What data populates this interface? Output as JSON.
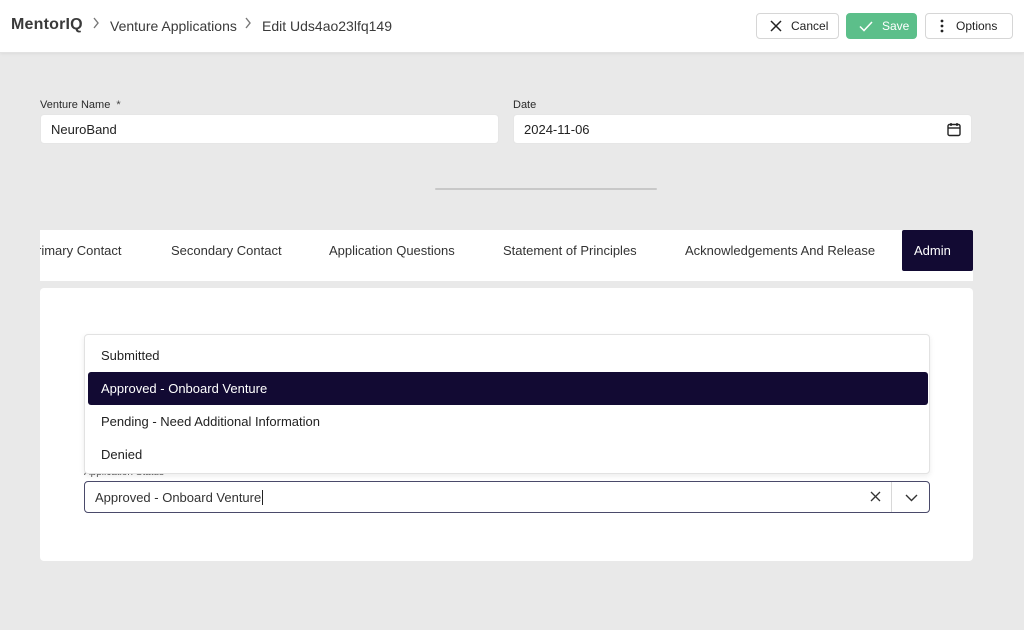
{
  "header": {
    "brand": "MentorIQ",
    "breadcrumbs": [
      "Venture Applications",
      "Edit Uds4ao23lfq149"
    ],
    "cancel_label": "Cancel",
    "save_label": "Save",
    "options_label": "Options"
  },
  "form": {
    "venture_name_label": "Venture Name",
    "venture_name_required": "*",
    "venture_name_value": "NeuroBand",
    "date_label": "Date",
    "date_value": "2024-11-06"
  },
  "tabs": [
    {
      "label": "rimary Contact",
      "active": false
    },
    {
      "label": "Secondary Contact",
      "active": false
    },
    {
      "label": "Application Questions",
      "active": false
    },
    {
      "label": "Statement of Principles",
      "active": false
    },
    {
      "label": "Acknowledgements And Release",
      "active": false
    },
    {
      "label": "Admin",
      "active": true
    }
  ],
  "admin": {
    "status_label": "Application Status",
    "status_value": "Approved - Onboard Venture",
    "options": [
      {
        "label": "Submitted",
        "selected": false
      },
      {
        "label": "Approved - Onboard Venture",
        "selected": true
      },
      {
        "label": "Pending - Need Additional Information",
        "selected": false
      },
      {
        "label": "Denied",
        "selected": false
      }
    ]
  },
  "colors": {
    "accent_dark": "#120a33",
    "save_green": "#5cbf8a",
    "background": "#e9e9e9"
  },
  "icons": [
    "chevron-right-icon",
    "close-icon",
    "check-icon",
    "more-vertical-icon",
    "calendar-icon",
    "chevron-down-icon"
  ]
}
